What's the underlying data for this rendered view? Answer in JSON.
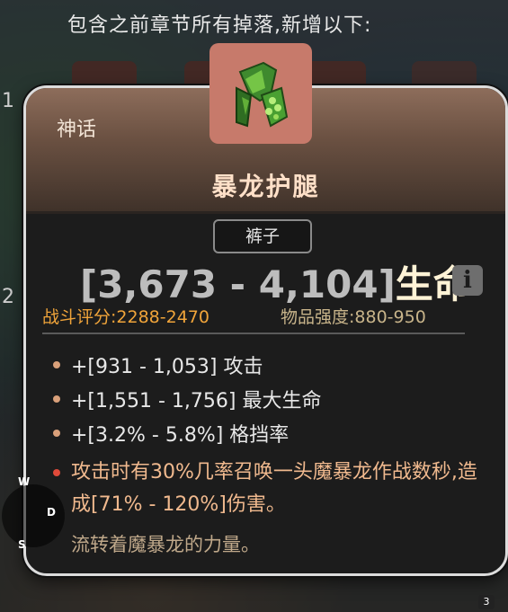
{
  "header": {
    "drops_text": "包含之前章节所有掉落,新增以下:"
  },
  "side_numbers": [
    "1",
    "2"
  ],
  "tooltip": {
    "rarity": "神话",
    "item_name": "暴龙护腿",
    "item_icon": "leg-armor-icon",
    "slot": "裤子",
    "main_stat": {
      "range": "[3,673 - 4,104]",
      "stat": "生命"
    },
    "info_icon": "i",
    "combat_score": "战斗评分:2288-2470",
    "item_power": "物品强度:880-950",
    "affixes": [
      "+[931 - 1,053] 攻击",
      "+[1,551 - 1,756] 最大生命",
      "+[3.2% - 5.8%] 格挡率"
    ],
    "unique_effect": "攻击时有30%几率召唤一头魔暴龙作战数秒,造成[71% - 120%]伤害。",
    "flavor_text": "流转着魔暴龙的力量。"
  },
  "compass": {
    "north": "W",
    "east": "D",
    "south": "S"
  },
  "badge_count": "3",
  "colors": {
    "rarity_header": "#8d6d5b",
    "item_name": "#ffe0c8",
    "combat_score": "#f0a43a",
    "unique_effect": "#f0b98e",
    "flavor": "#bfa88a"
  }
}
